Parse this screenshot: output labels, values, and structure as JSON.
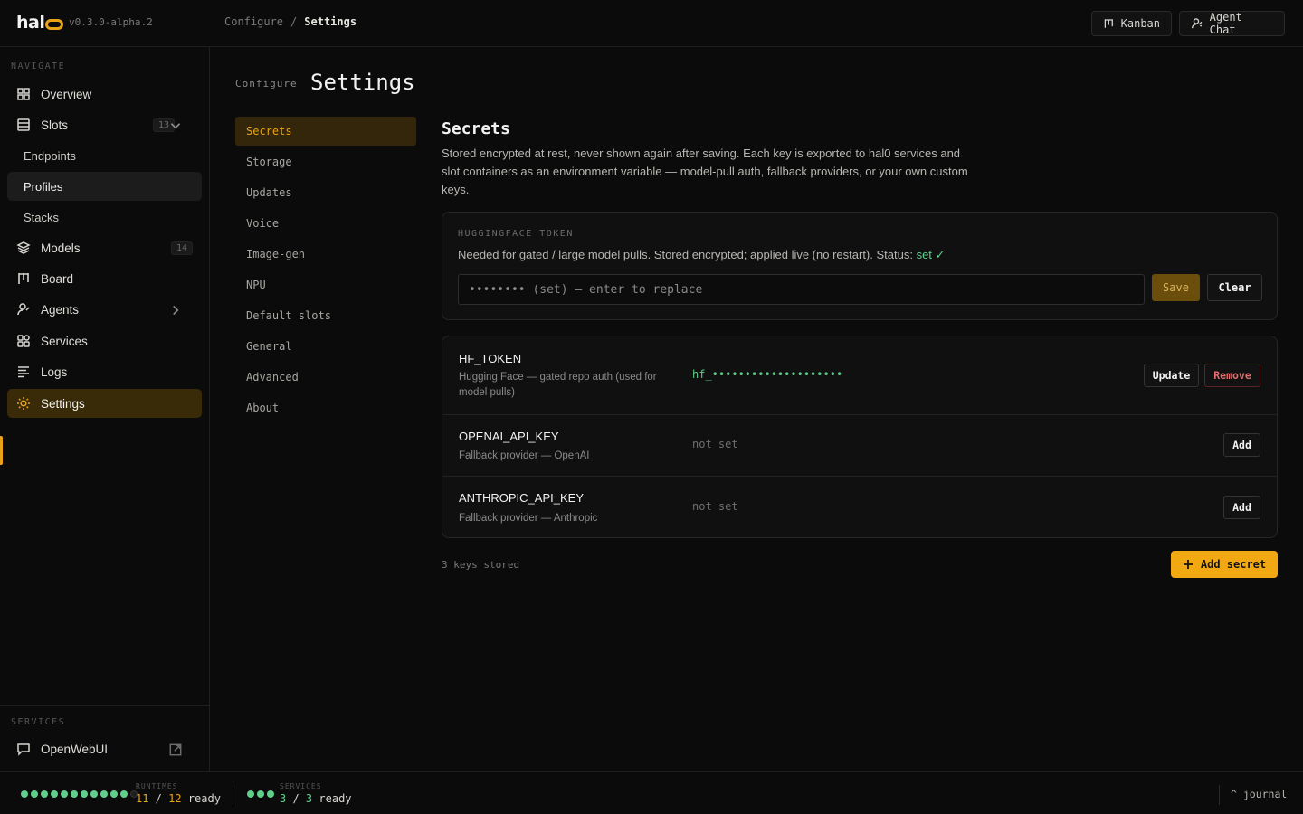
{
  "app": {
    "logo": "hal",
    "version": "v0.3.0-alpha.2"
  },
  "breadcrumb": {
    "parent": "Configure",
    "separator": "/",
    "current": "Settings"
  },
  "top_actions": {
    "kanban": "Kanban",
    "agent_chat": "Agent Chat"
  },
  "sidebar": {
    "navigate_label": "NAVIGATE",
    "overview": "Overview",
    "slots": "Slots",
    "slots_count": "13",
    "endpoints": "Endpoints",
    "profiles": "Profiles",
    "stacks": "Stacks",
    "models": "Models",
    "models_count": "14",
    "board": "Board",
    "agents": "Agents",
    "services": "Services",
    "logs": "Logs",
    "settings": "Settings",
    "services_label": "SERVICES",
    "openwebui": "OpenWebUI"
  },
  "page": {
    "eyebrow": "Configure",
    "title": "Settings"
  },
  "settings_nav": [
    "Secrets",
    "Storage",
    "Updates",
    "Voice",
    "Image-gen",
    "NPU",
    "Default slots",
    "General",
    "Advanced",
    "About"
  ],
  "secrets": {
    "title": "Secrets",
    "description": "Stored encrypted at rest, never shown again after saving. Each key is exported to hal0 services and slot containers as an environment variable — model-pull auth, fallback providers, or your own custom keys.",
    "hf_card": {
      "label": "HUGGINGFACE TOKEN",
      "description": "Needed for gated / large model pulls. Stored encrypted; applied live (no restart). Status: ",
      "status": "set ✓",
      "placeholder": "•••••••• (set) — enter to replace",
      "save": "Save",
      "clear": "Clear"
    },
    "keys": [
      {
        "name": "HF_TOKEN",
        "description": "Hugging Face — gated repo auth (used for model pulls)",
        "value": "hf_••••••••••••••••••••",
        "primary_action": "Update",
        "secondary_action": "Remove"
      },
      {
        "name": "OPENAI_API_KEY",
        "description": "Fallback provider — OpenAI",
        "value": "not set",
        "primary_action": "Add"
      },
      {
        "name": "ANTHROPIC_API_KEY",
        "description": "Fallback provider — Anthropic",
        "value": "not set",
        "primary_action": "Add"
      }
    ],
    "keys_count": "3 keys stored",
    "add_secret": "Add secret"
  },
  "footer": {
    "runtimes_label": "RUNTIMES",
    "runtimes_ready": "11",
    "runtimes_total": "12",
    "runtimes_suffix": "ready",
    "services_label": "SERVICES",
    "services_ready": "3",
    "services_total": "3",
    "services_suffix": "ready",
    "journal": "^ journal"
  },
  "colors": {
    "accent": "#e8a317",
    "success": "#5fcf8b",
    "danger": "#e46d6d",
    "background": "#0b0b0b"
  }
}
